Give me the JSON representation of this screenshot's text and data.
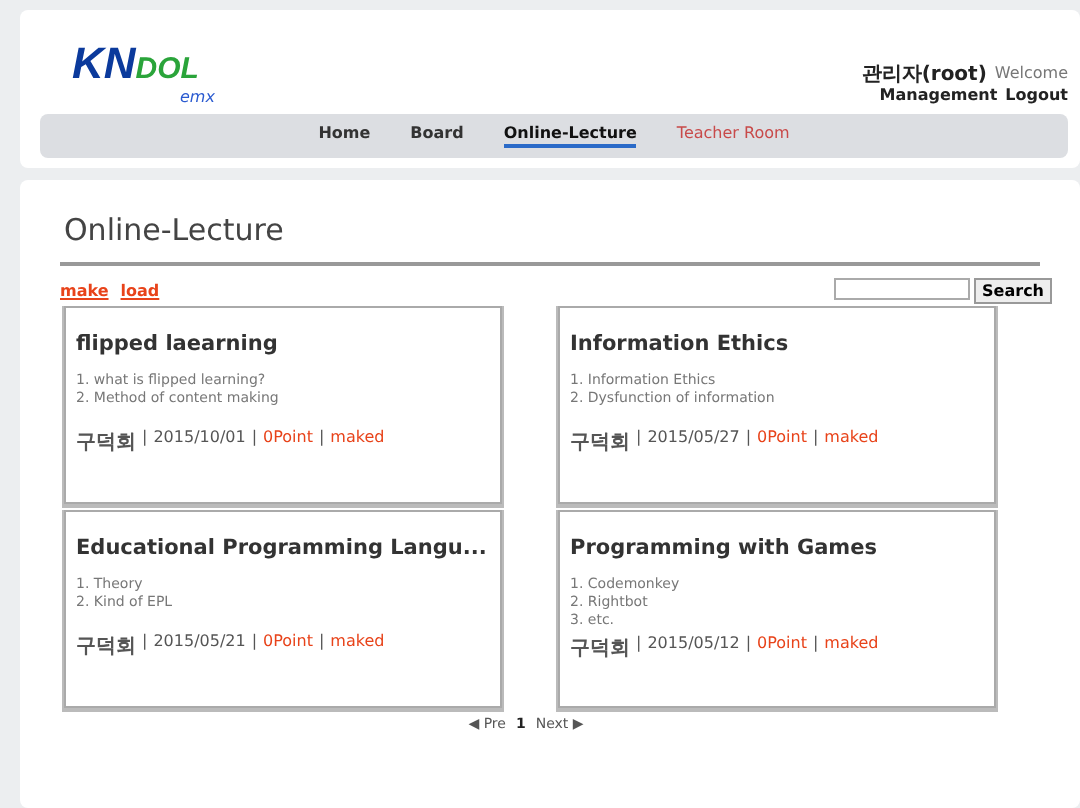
{
  "header": {
    "logo": {
      "main": "KN",
      "accent": "DOL",
      "sub": "emx"
    },
    "user": {
      "name": "관리자(root)",
      "greeting": "Welcome"
    },
    "links": [
      "Management",
      "Logout"
    ]
  },
  "nav": [
    {
      "label": "Home",
      "selected": false,
      "accent": false
    },
    {
      "label": "Board",
      "selected": false,
      "accent": false
    },
    {
      "label": "Online-Lecture",
      "selected": true,
      "accent": false
    },
    {
      "label": "Teacher Room",
      "selected": false,
      "accent": true
    }
  ],
  "page_title": "Online-Lecture",
  "actions": [
    "make",
    "load"
  ],
  "search": {
    "button": "Search"
  },
  "lectures": [
    {
      "title": "flipped laearning",
      "items": [
        "1. what is flipped learning?",
        "2. Method of content making"
      ],
      "author": "구덕회",
      "separator": "|",
      "date": "2015/10/01",
      "points": "0Point",
      "status": "maked"
    },
    {
      "title": "Information Ethics",
      "items": [
        "1. Information Ethics",
        "2. Dysfunction of information"
      ],
      "author": "구덕회",
      "separator": "|",
      "date": "2015/05/27",
      "points": "0Point",
      "status": "maked"
    },
    {
      "title": "Educational Programming Langu...",
      "items": [
        "1. Theory",
        "2. Kind of EPL"
      ],
      "author": "구덕회",
      "separator": "|",
      "date": "2015/05/21",
      "points": "0Point",
      "status": "maked"
    },
    {
      "title": "Programming with Games",
      "items": [
        "1. Codemonkey",
        "2. Rightbot",
        "3. etc."
      ],
      "author": "구덕회",
      "separator": "|",
      "date": "2015/05/12",
      "points": "0Point",
      "status": "maked"
    }
  ],
  "pagination": {
    "prev": "◀ Pre",
    "pages": [
      {
        "label": "1",
        "selected": true
      }
    ],
    "next": "Next ▶"
  }
}
